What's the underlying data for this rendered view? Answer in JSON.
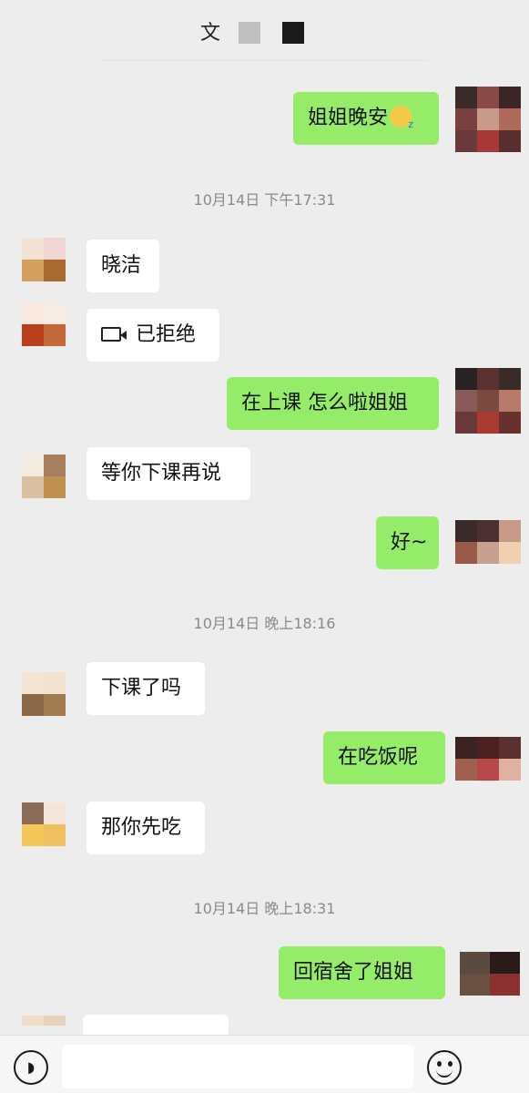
{
  "header": {
    "title": "文"
  },
  "messages": [
    {
      "dir": "out",
      "text": "姐姐晚安",
      "emoji": "sleeping-face"
    },
    {
      "timestamp": "10月14日 下午17:31"
    },
    {
      "dir": "in",
      "text": "晓洁"
    },
    {
      "dir": "in",
      "text": "已拒绝",
      "icon": "video-call-icon"
    },
    {
      "dir": "out",
      "text": "在上课 怎么啦姐姐"
    },
    {
      "dir": "in",
      "text": "等你下课再说"
    },
    {
      "dir": "out",
      "text": "好~"
    },
    {
      "timestamp": "10月14日 晚上18:16"
    },
    {
      "dir": "in",
      "text": "下课了吗"
    },
    {
      "dir": "out",
      "text": "在吃饭呢"
    },
    {
      "dir": "in",
      "text": "那你先吃"
    },
    {
      "timestamp": "10月14日 晚上18:31"
    },
    {
      "dir": "out",
      "text": "回宿舍了姐姐"
    }
  ],
  "input_bar": {
    "voice_icon": "voice-icon",
    "emoji_icon": "emoji-icon",
    "input_value": ""
  }
}
